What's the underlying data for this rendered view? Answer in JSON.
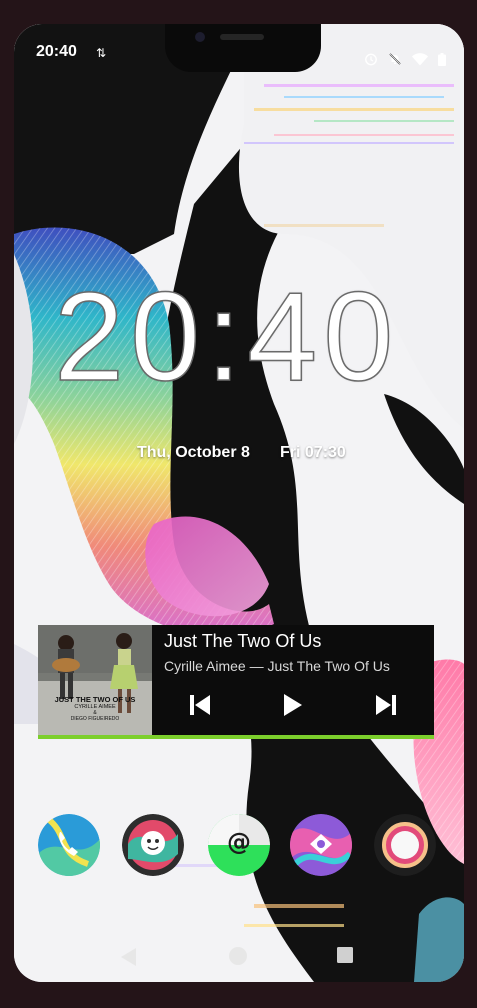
{
  "status_bar": {
    "time": "20:40",
    "data_icon": "data-transfer-icon",
    "right_icons": [
      "alarm-icon",
      "notifications-off-icon",
      "wifi-icon",
      "battery-icon"
    ]
  },
  "lockscreen": {
    "clock": "20:40",
    "date": "Thu, October 8",
    "next_alarm": "Fri 07:30"
  },
  "media_player": {
    "title": "Just The Two Of Us",
    "subtitle": "Cyrille Aimee — Just The Two Of Us",
    "album_title": "JUST THE TWO OF US",
    "album_artist": "CYRILLE AIMEE",
    "album_line3": "&",
    "album_line4": "DIEGO FIGUEIREDO",
    "controls": [
      "previous-icon",
      "play-icon",
      "next-icon"
    ],
    "accent_color": "#7ccf2c"
  },
  "dock": {
    "apps": [
      "phone-app-icon",
      "messages-app-icon",
      "email-app-icon",
      "browser-app-icon",
      "camera-app-icon"
    ]
  },
  "navigation": {
    "buttons": [
      "back-icon",
      "home-icon",
      "recents-icon"
    ]
  }
}
